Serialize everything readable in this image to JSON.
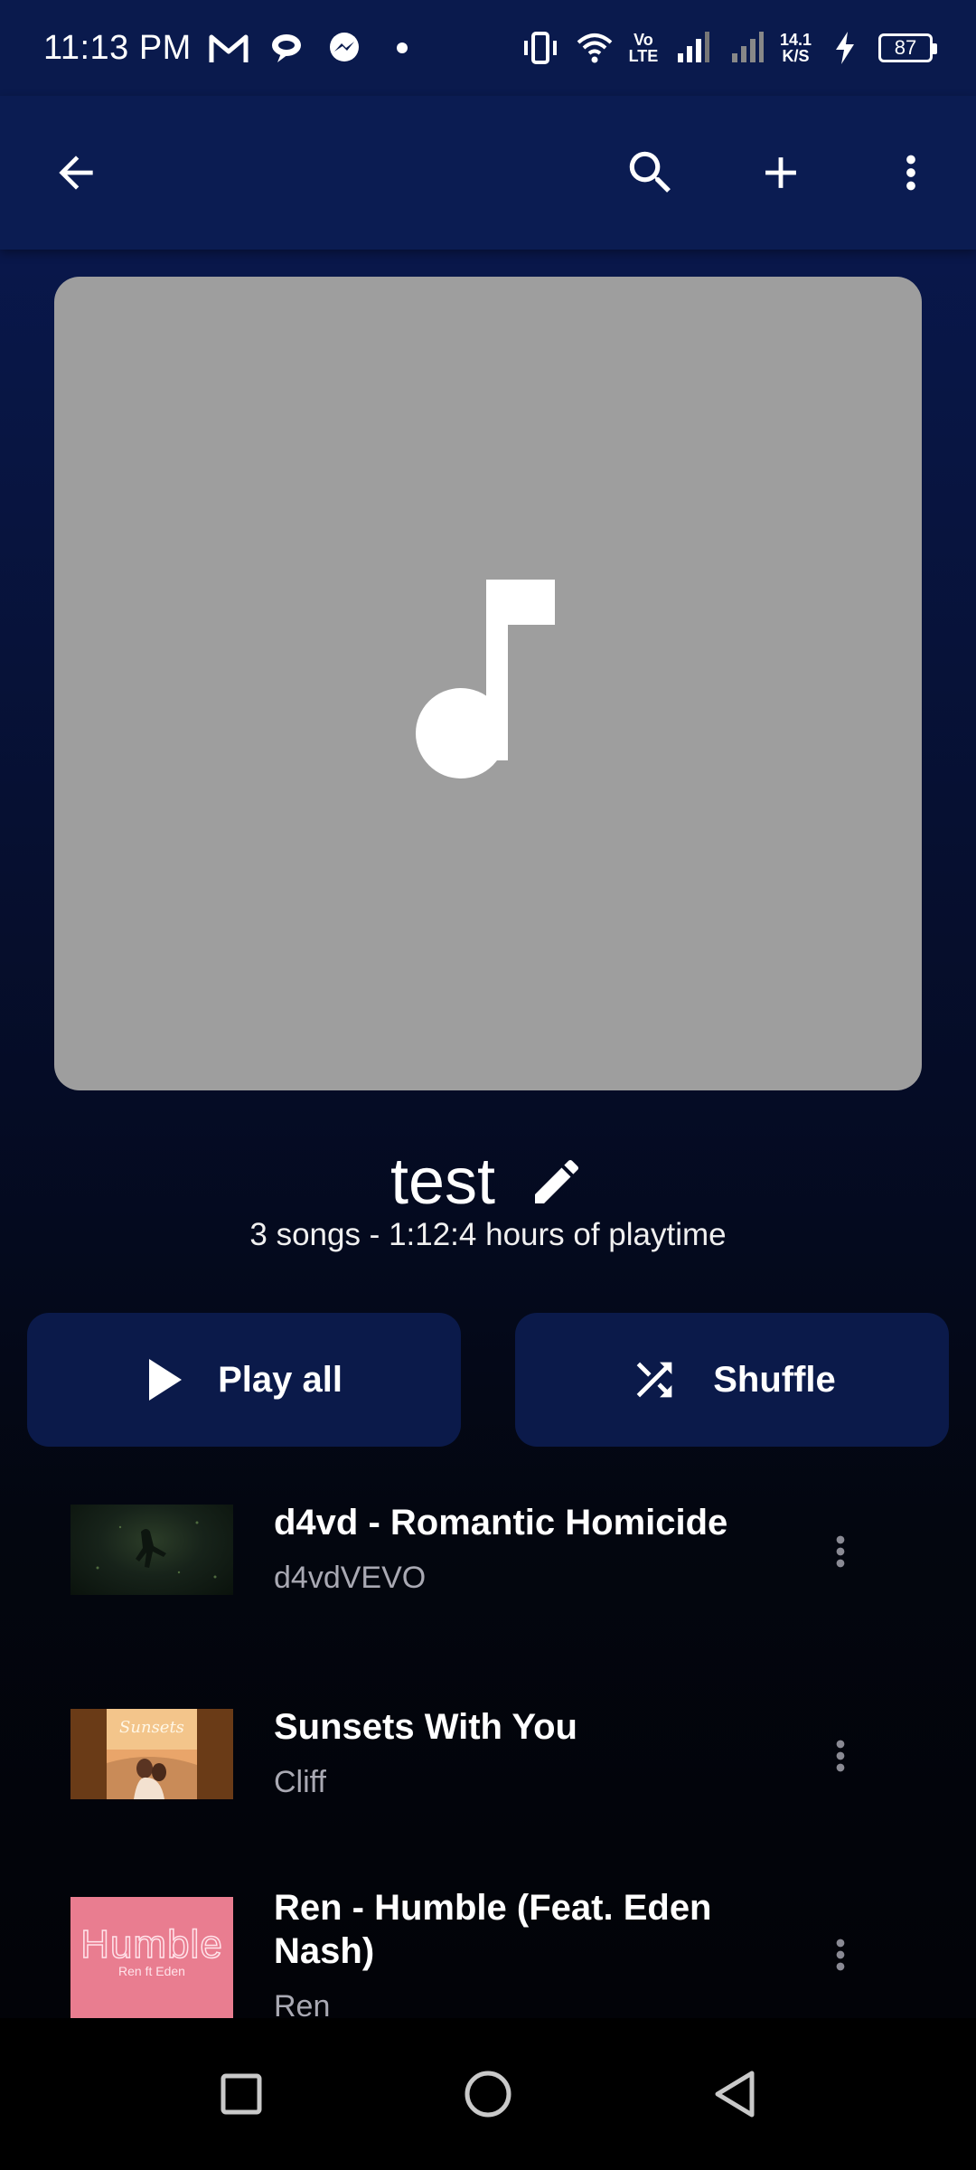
{
  "status_bar": {
    "time": "11:13 PM",
    "net_speed_value": "14.1",
    "net_speed_unit": "K/S",
    "battery": "87",
    "volte_label": "Vo LTE"
  },
  "app_bar": {
    "back_icon": "arrow-back-icon",
    "search_icon": "search-icon",
    "add_icon": "add-icon",
    "more_icon": "more-vert-icon"
  },
  "playlist": {
    "title": "test",
    "subtitle": "3 songs - 1:12:4 hours of playtime",
    "cover_icon": "music-note-icon"
  },
  "actions": {
    "play_all": "Play all",
    "shuffle": "Shuffle"
  },
  "songs": [
    {
      "title": "d4vd - Romantic Homicide",
      "artist": "d4vdVEVO"
    },
    {
      "title": "Sunsets With You",
      "artist": "Cliff"
    },
    {
      "title": "Ren  - Humble (Feat. Eden Nash)",
      "artist": "Ren",
      "thumb_text": "Humble",
      "thumb_subtext": "Ren ft Eden"
    }
  ],
  "colors": {
    "app_bar": "#0b1c52",
    "button_bg": "#0b1a4a",
    "cover_bg": "#9e9e9e",
    "artist_text": "#a9a9b3"
  }
}
